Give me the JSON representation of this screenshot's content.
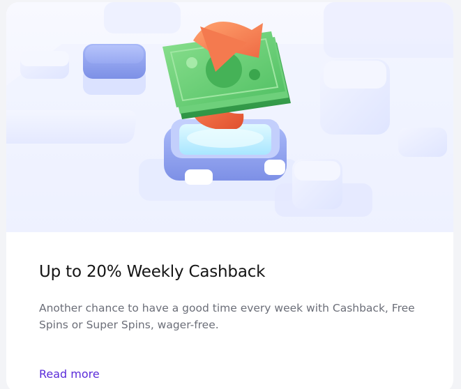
{
  "card": {
    "title": "Up to 20% Weekly Cashback",
    "description": "Another chance to have a good time every week with Cashback, Free Spins or Super Spins, wager-free.",
    "link_label": "Read more",
    "illustration": "cashback-money-arrow-illustration"
  },
  "colors": {
    "accent_link": "#5a2bd9",
    "title_text": "#141414",
    "body_text": "#6b6e78",
    "money_green": "#58c86a",
    "arrow_orange": "#f2724a",
    "platform_blue": "#8fa2ee"
  }
}
